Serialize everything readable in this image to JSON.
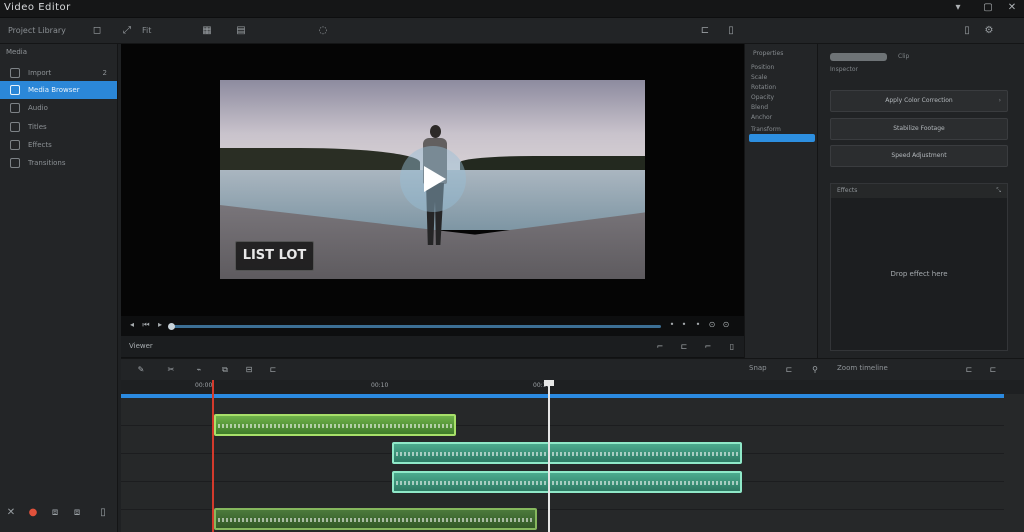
{
  "app": {
    "title": "Video Editor"
  },
  "window_controls": {
    "minimize": "▾",
    "restore": "▢",
    "close": "✕"
  },
  "toolbar": {
    "breadcrumb": "Project Library",
    "zoom_label": "Fit"
  },
  "sidebar": {
    "header": "Media",
    "items": [
      {
        "label": "Import",
        "badge": "2",
        "icon": "import-icon",
        "active": false
      },
      {
        "label": "Media Browser",
        "badge": "",
        "icon": "media-icon",
        "active": true
      },
      {
        "label": "Audio",
        "badge": "",
        "icon": "audio-icon",
        "active": false
      },
      {
        "label": "Titles",
        "badge": "",
        "icon": "text-icon",
        "active": false
      },
      {
        "label": "Effects",
        "badge": "",
        "icon": "effects-icon",
        "active": false
      },
      {
        "label": "Transitions",
        "badge": "",
        "icon": "transition-icon",
        "active": false
      }
    ]
  },
  "preview": {
    "caption_text": "LIST LOT"
  },
  "viewer_bar": {
    "label": "Viewer"
  },
  "properties": {
    "title": "Properties",
    "rows": [
      "Position",
      "Scale",
      "Rotation",
      "Opacity",
      "Blend",
      "Anchor"
    ],
    "section": "Transform"
  },
  "right_panel": {
    "top_label": "Inspector",
    "top_small": "Clip",
    "buttons": [
      "Apply Color Correction",
      "Stabilize Footage",
      "Speed Adjustment"
    ],
    "drop_header": "Effects",
    "drop_message": "Drop effect here"
  },
  "timeline_toolbar": {
    "snap_label": "Snap",
    "zoom_label": "Zoom timeline"
  },
  "timeline": {
    "ruler_ticks": [
      "00:00",
      "00:10",
      "00:20"
    ],
    "playhead_time": "00:19"
  },
  "colors": {
    "accent": "#2b87d8",
    "record": "#e0513b",
    "clip_green": "#6fb24a",
    "clip_teal": "#4caa8e"
  }
}
